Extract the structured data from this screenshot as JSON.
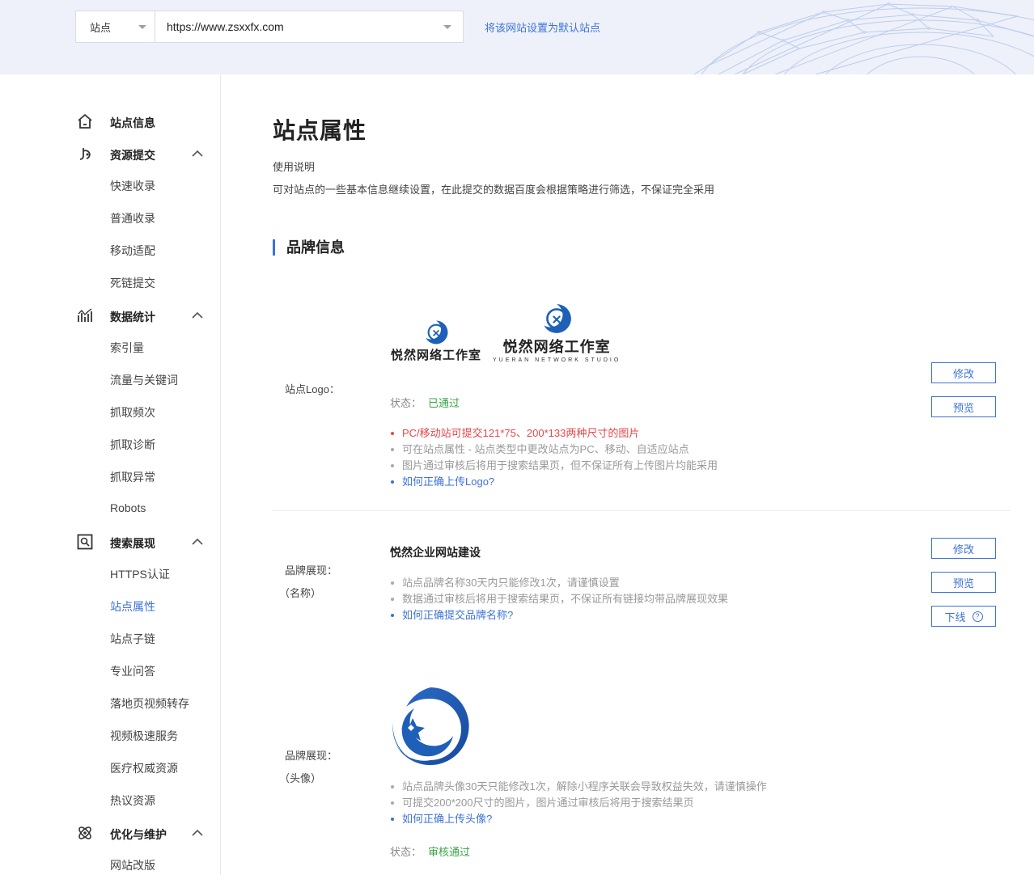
{
  "header": {
    "site_type": "站点",
    "site_url": "https://www.zsxxfx.com",
    "default_link": "将该网站设置为默认站点"
  },
  "sidebar": {
    "groups": [
      {
        "label": "站点信息",
        "icon": "home-icon",
        "items": []
      },
      {
        "label": "资源提交",
        "icon": "submit-icon",
        "items": [
          "快速收录",
          "普通收录",
          "移动适配",
          "死链提交"
        ]
      },
      {
        "label": "数据统计",
        "icon": "chart-icon",
        "items": [
          "索引量",
          "流量与关键词",
          "抓取频次",
          "抓取诊断",
          "抓取异常",
          "Robots"
        ]
      },
      {
        "label": "搜索展现",
        "icon": "search-display-icon",
        "items": [
          "HTTPS认证",
          "站点属性",
          "站点子链",
          "专业问答",
          "落地页视频转存",
          "视频极速服务",
          "医疗权威资源",
          "热议资源"
        ]
      },
      {
        "label": "优化与维护",
        "icon": "optimize-icon",
        "items": [
          "网站改版"
        ]
      }
    ],
    "active_item": "站点属性"
  },
  "main": {
    "title": "站点属性",
    "usage_title": "使用说明",
    "usage_desc": "可对站点的一些基本信息继续设置，在此提交的数据百度会根据策略进行筛选，不保证完全采用",
    "section_title": "品牌信息",
    "logo_row": {
      "label": "站点Logo：",
      "logo_small_text": "悦然网络工作室",
      "logo_large_text": "悦然网络工作室",
      "logo_large_en": "YUERAN NETWORK STUDIO",
      "status_label": "状态：",
      "status_value": "已通过",
      "tips": [
        "PC/移动站可提交121*75、200*133两种尺寸的图片",
        "可在站点属性 - 站点类型中更改站点为PC、移动、自适应站点",
        "图片通过审核后将用于搜索结果页，但不保证所有上传图片均能采用",
        "如何正确上传Logo?"
      ],
      "edit_btn": "修改",
      "preview_btn": "预览"
    },
    "brand_name_row": {
      "label_line1": "品牌展现：",
      "label_line2": "（名称）",
      "name": "悦然企业网站建设",
      "tips": [
        "站点品牌名称30天内只能修改1次，请谨慎设置",
        "数据通过审核后将用于搜索结果页，不保证所有链接均带品牌展现效果",
        "如何正确提交品牌名称?"
      ],
      "edit_btn": "修改",
      "preview_btn": "预览",
      "offline_btn": "下线",
      "help_glyph": "?"
    },
    "brand_avatar_row": {
      "label_line1": "品牌展现：",
      "label_line2": "（头像）",
      "tips": [
        "站点品牌头像30天只能修改1次，解除小程序关联会导致权益失效，请谨慎操作",
        "可提交200*200尺寸的图片，图片通过审核后将用于搜索结果页",
        "如何正确上传头像?"
      ],
      "status_label": "状态：",
      "status_value": "审核通过"
    }
  },
  "colors": {
    "accent": "#3c72d8",
    "success": "#3aa347",
    "warning": "#e8464a",
    "logo_blue": "#1e5fb8"
  }
}
